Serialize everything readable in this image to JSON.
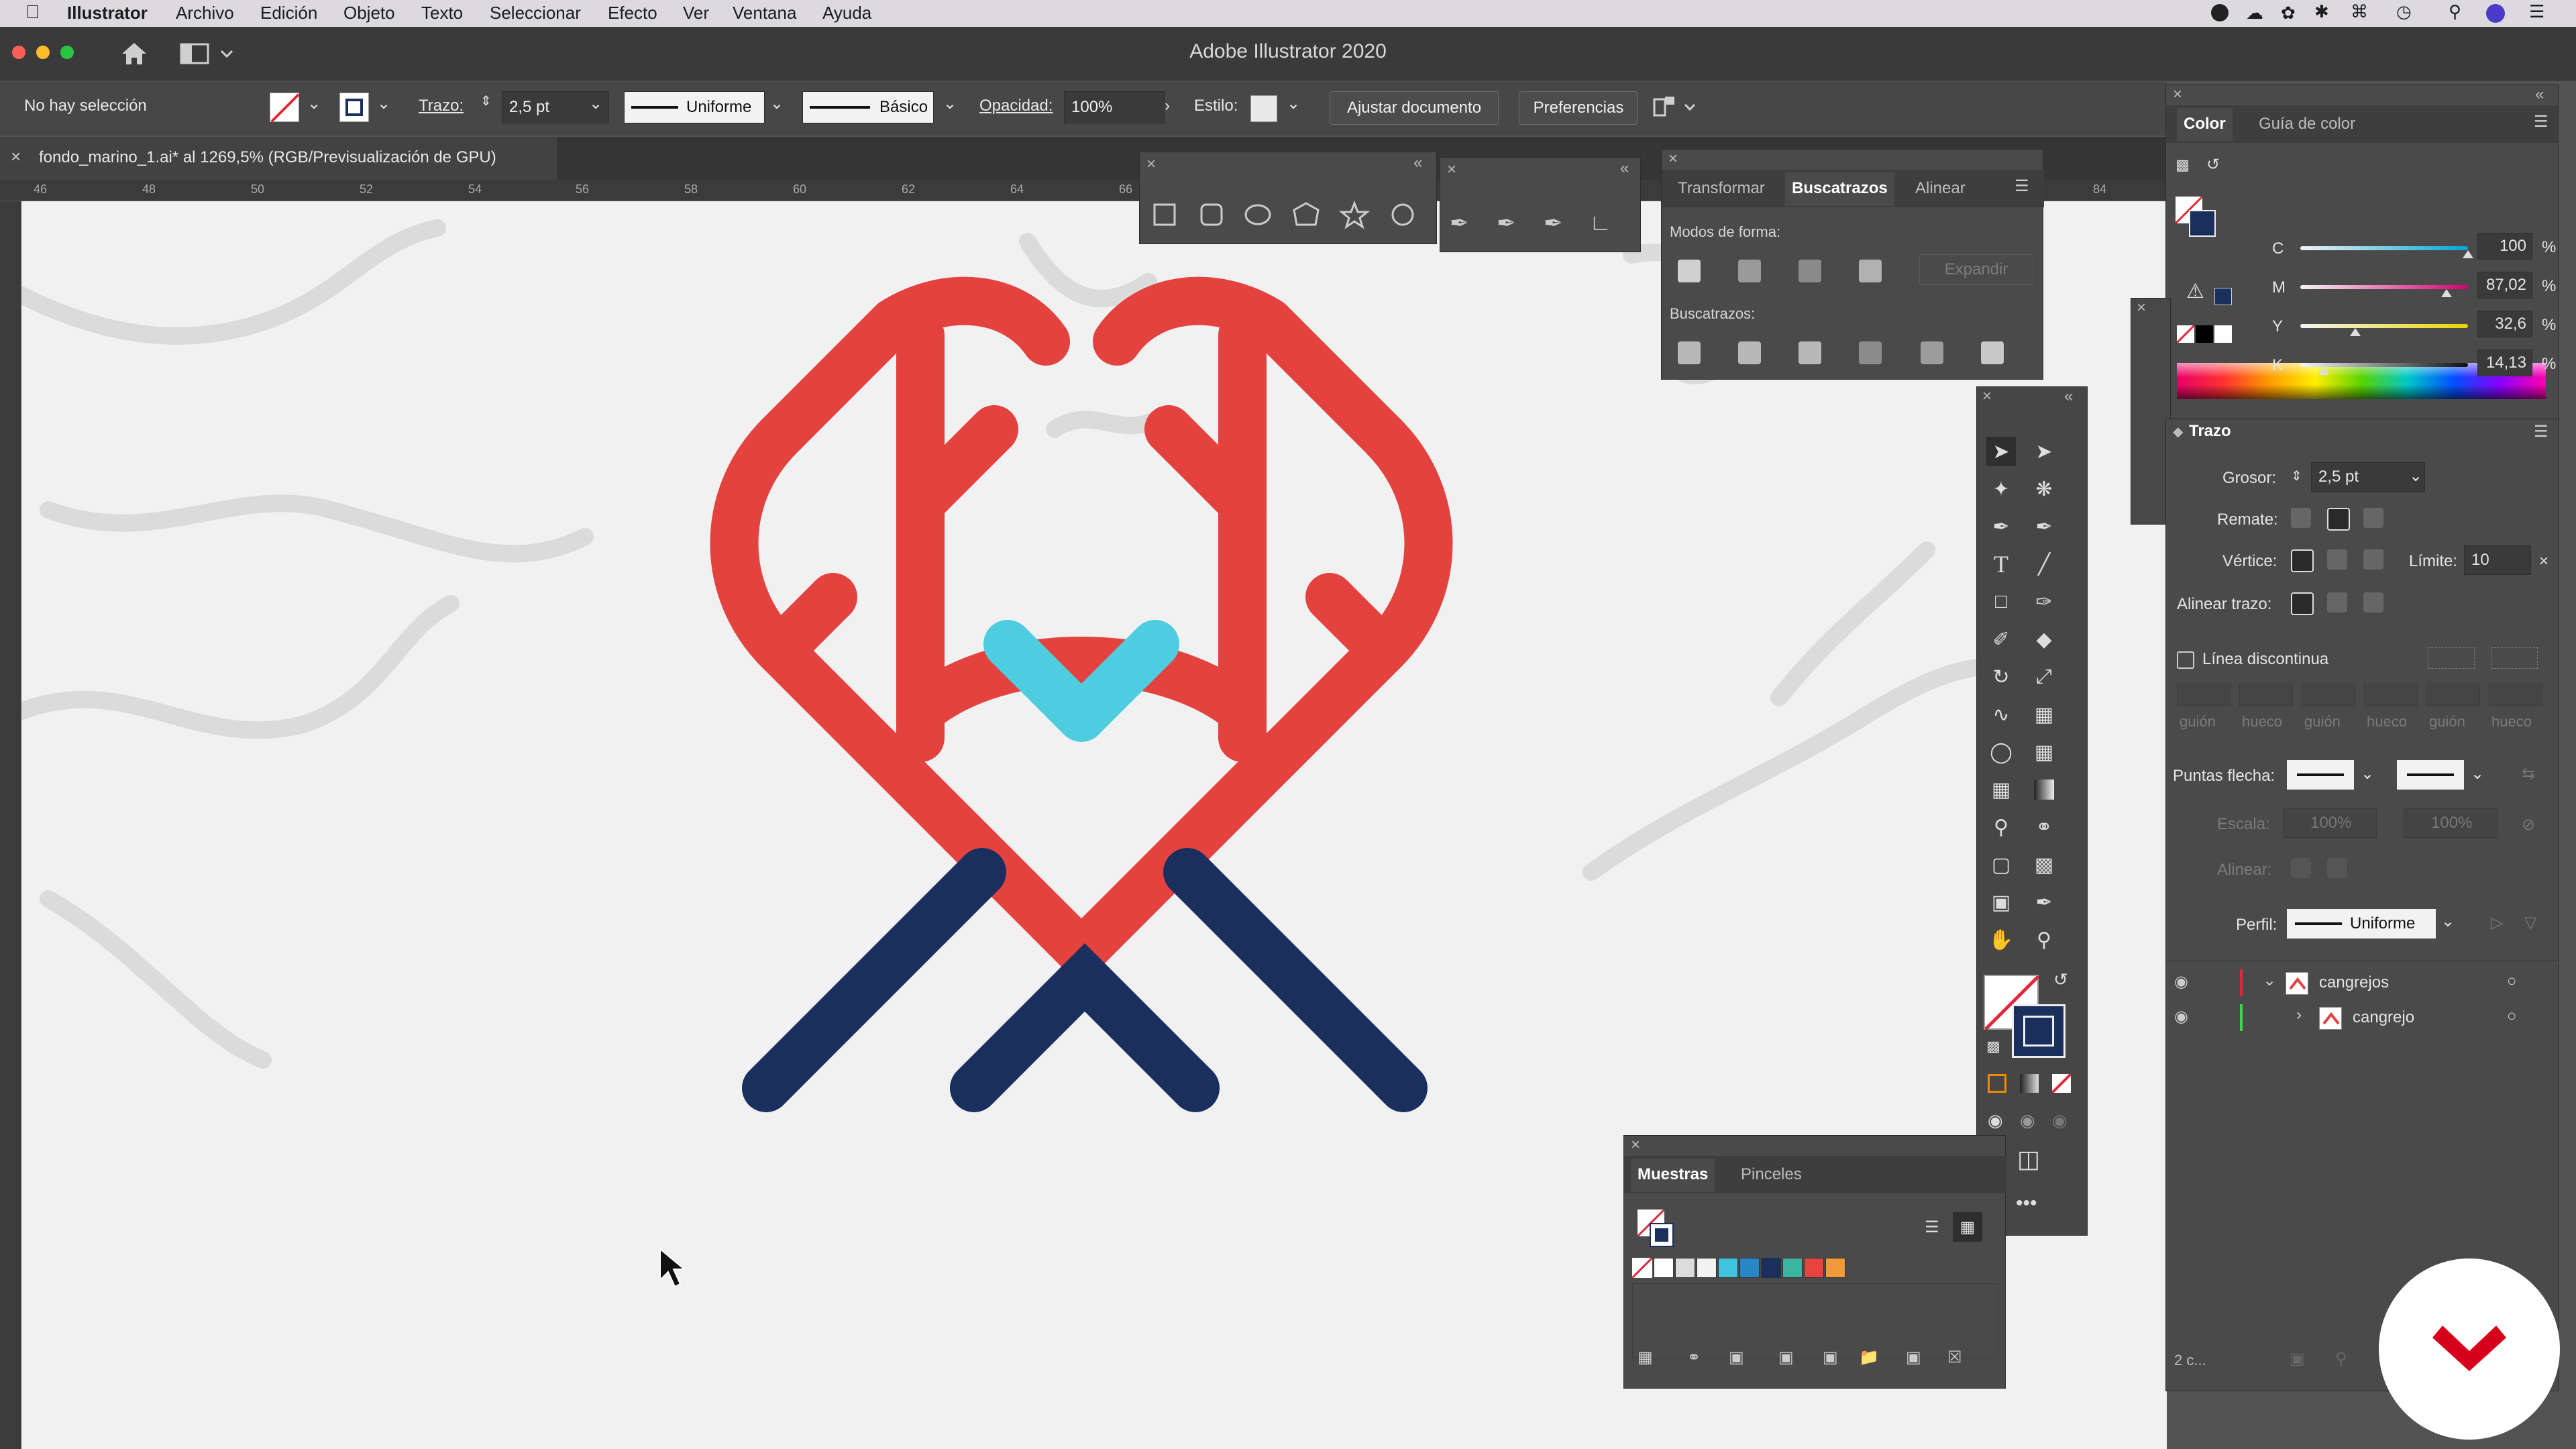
{
  "menubar": {
    "app": "Illustrator",
    "items": [
      "Archivo",
      "Edición",
      "Objeto",
      "Texto",
      "Seleccionar",
      "Efecto",
      "Ver",
      "Ventana",
      "Ayuda"
    ]
  },
  "titlebar": {
    "title": "Adobe Illustrator 2020"
  },
  "control": {
    "selection": "No hay selección",
    "stroke_label": "Trazo:",
    "stroke_value": "2,5 pt",
    "stroke_profile": "Uniforme",
    "brush": "Básico",
    "opacity_label": "Opacidad:",
    "opacity_value": "100%",
    "style_label": "Estilo:",
    "fit_button": "Ajustar documento",
    "prefs_button": "Preferencias"
  },
  "document": {
    "tab_title": "fondo_marino_1.ai* al 1269,5% (RGB/Previsualización de GPU)",
    "ruler_ticks": [
      "46",
      "48",
      "50",
      "52",
      "54",
      "56",
      "58",
      "60",
      "62",
      "64",
      "66",
      "84"
    ]
  },
  "pathfinder": {
    "tabs": [
      "Transformar",
      "Buscatrazos",
      "Alinear"
    ],
    "active_tab": "Buscatrazos",
    "shape_modes_label": "Modos de forma:",
    "expand_button": "Expandir",
    "pathfinders_label": "Buscatrazos:"
  },
  "color_panel": {
    "tabs": [
      "Color",
      "Guía de color"
    ],
    "channels": [
      {
        "name": "C",
        "value": "100",
        "unit": "%",
        "level": 1.0,
        "color": "#00a6d6"
      },
      {
        "name": "M",
        "value": "87,02",
        "unit": "%",
        "level": 0.8702,
        "color": "#d6006f"
      },
      {
        "name": "Y",
        "value": "32,6",
        "unit": "%",
        "level": 0.326,
        "color": "#e8d400"
      },
      {
        "name": "K",
        "value": "14,13",
        "unit": "%",
        "level": 0.1413,
        "color": "#111111"
      }
    ]
  },
  "stroke_panel": {
    "title": "Trazo",
    "weight_label": "Grosor:",
    "weight_value": "2,5 pt",
    "cap_label": "Remate:",
    "corner_label": "Vértice:",
    "limit_label": "Límite:",
    "limit_value": "10",
    "align_label": "Alinear trazo:",
    "dashed_label": "Línea discontinua",
    "dash_labels": [
      "guión",
      "hueco",
      "guión",
      "hueco",
      "guión",
      "hueco"
    ],
    "arrowheads_label": "Puntas flecha:",
    "scale_label": "Escala:",
    "scale_values": [
      "100%",
      "100%"
    ],
    "align_arrows_label": "Alinear:",
    "profile_label": "Perfil:",
    "profile_value": "Uniforme"
  },
  "layers": {
    "items": [
      {
        "name": "cangrejos",
        "color": "#e0283a",
        "expanded": true
      },
      {
        "name": "cangrejo",
        "color": "#3cd64a",
        "expanded": false
      }
    ],
    "footer": "2 c..."
  },
  "swatches": {
    "tabs": [
      "Muestras",
      "Pinceles"
    ],
    "colors": [
      "#ffffff",
      "#dcdcdc",
      "#f2f2f2",
      "#3ec4dc",
      "#2b86c8",
      "#1a2f5e",
      "#3bb5a0",
      "#e8433d",
      "#f09a3a"
    ]
  },
  "colors": {
    "crab_red": "#e3423f",
    "crab_navy": "#1a2f5e",
    "crab_cyan": "#4fcde0",
    "panel_bg": "#4a4a4a"
  }
}
